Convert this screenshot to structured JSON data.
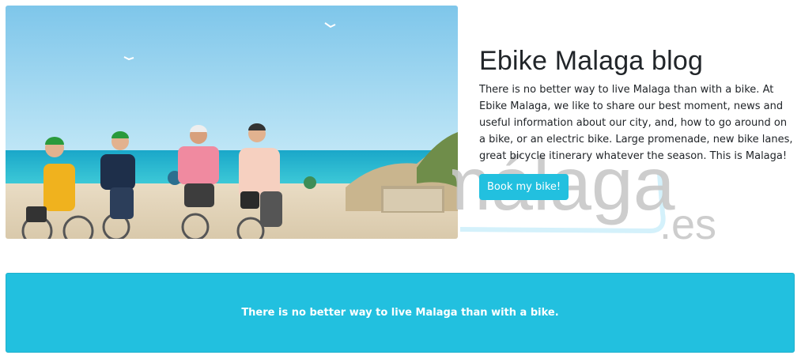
{
  "hero": {
    "image_alt": "Cyclists riding bikes along the beach promenade in Malaga"
  },
  "watermark": {
    "main_text": "málaga",
    "suffix_text": ".es"
  },
  "blog": {
    "title": "Ebike Malaga blog",
    "intro": "There is no better way to live Malaga than with a bike. At Ebike Malaga, we like to share our best moment, news and useful information about our city, and, how to go around on a bike, or an electric bike. Large promenade, new bike lanes, great bicycle itinerary whatever the season. This is Malaga!",
    "cta_label": "Book my bike!"
  },
  "banner": {
    "text": "There is no better way to live Malaga than with a bike."
  },
  "colors": {
    "accent": "#22c0df",
    "text": "#212529",
    "watermark": "#c8c8c8"
  }
}
